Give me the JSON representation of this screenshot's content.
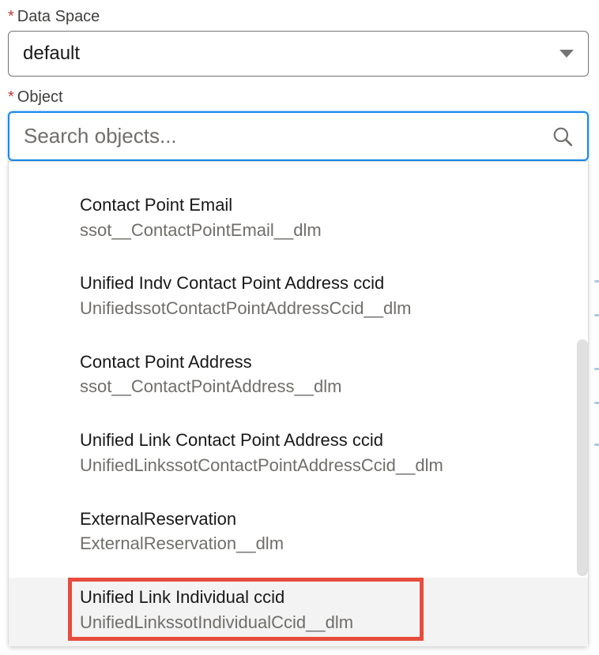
{
  "dataSpace": {
    "label": "Data Space",
    "value": "default"
  },
  "object": {
    "label": "Object",
    "placeholder": "Search objects..."
  },
  "options": [
    {
      "label": "Contact Point Email",
      "api": "ssot__ContactPointEmail__dlm"
    },
    {
      "label": "Unified Indv Contact Point Address ccid",
      "api": "UnifiedssotContactPointAddressCcid__dlm"
    },
    {
      "label": "Contact Point Address",
      "api": "ssot__ContactPointAddress__dlm"
    },
    {
      "label": "Unified Link Contact Point Address ccid",
      "api": "UnifiedLinkssotContactPointAddressCcid__dlm"
    },
    {
      "label": "ExternalReservation",
      "api": "ExternalReservation__dlm"
    },
    {
      "label": "Unified Link Individual ccid",
      "api": "UnifiedLinkssotIndividualCcid__dlm"
    }
  ]
}
